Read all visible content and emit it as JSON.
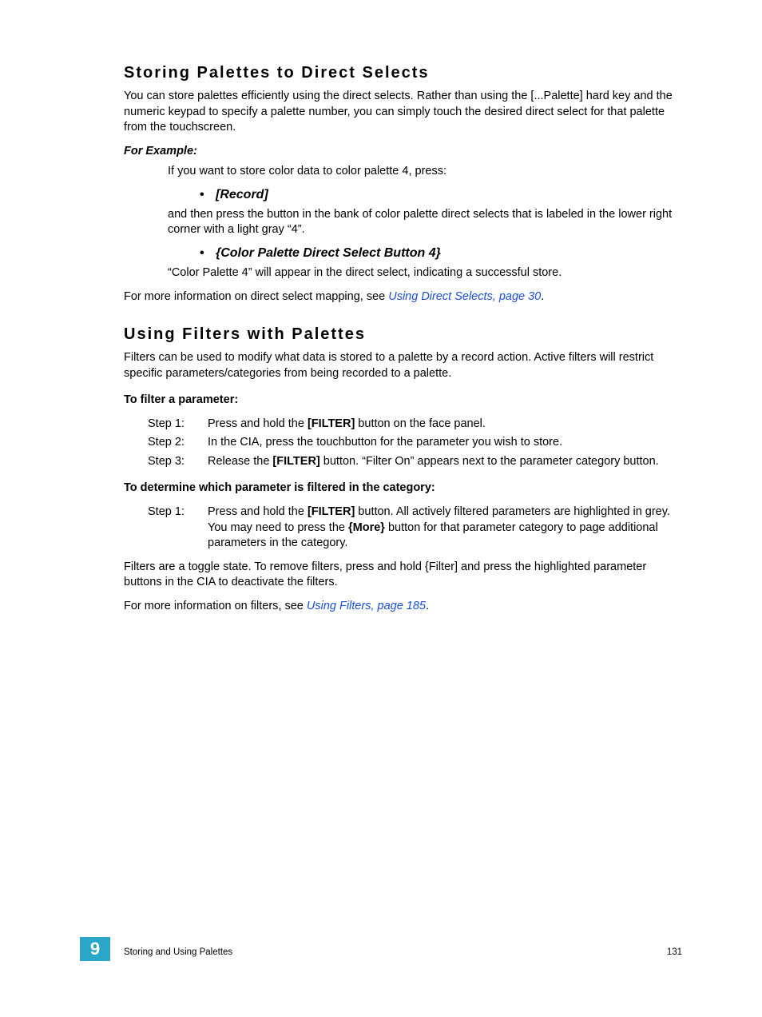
{
  "section1": {
    "heading": "Storing Palettes to Direct Selects",
    "intro": "You can store palettes efficiently using the direct selects. Rather than using the [...Palette] hard key and the numeric keypad to specify a palette number, you can simply touch the desired direct select for that palette from the touchscreen.",
    "example_label": "For Example:",
    "example_intro": "If you want to store color data to color palette 4, press:",
    "bullet1": "[Record]",
    "example_mid": "and then press the button in the bank of color palette direct selects that is labeled in the lower right corner with a light gray “4”.",
    "bullet2": "{Color Palette Direct Select Button 4}",
    "example_result": "“Color Palette 4” will appear in the direct select, indicating a successful store.",
    "more_info_pre": "For more information on direct select mapping, see ",
    "more_info_link": "Using Direct Selects, page 30",
    "more_info_post": "."
  },
  "section2": {
    "heading": "Using Filters with Palettes",
    "intro": "Filters can be used to modify what data is stored to a palette by a record action. Active filters will restrict specific parameters/categories from being recorded to a palette.",
    "filter_param_label": "To filter a parameter:",
    "steps_a": [
      {
        "label": "Step 1:",
        "pre": "Press and hold the ",
        "bold": "[FILTER]",
        "post": " button on the face panel."
      },
      {
        "label": "Step 2:",
        "text": "In the CIA, press the touchbutton for the parameter you wish to store."
      },
      {
        "label": "Step 3:",
        "pre": "Release the ",
        "bold": "[FILTER]",
        "post": " button. “Filter On” appears next to the parameter category button."
      }
    ],
    "determine_label": "To determine which parameter is filtered in the category:",
    "steps_b": [
      {
        "label": "Step 1:",
        "pre": "Press and hold the ",
        "bold1": "[FILTER]",
        "mid": " button. All actively filtered parameters are highlighted in grey. You may need to press the ",
        "bold2": "{More}",
        "post": " button for that parameter category to page additional parameters in the category."
      }
    ],
    "toggle": "Filters are a toggle state. To remove filters, press and hold {Filter] and press the highlighted parameter buttons in the CIA to deactivate the filters.",
    "more_info_pre": "For more information on filters, see ",
    "more_info_link": "Using Filters, page 185",
    "more_info_post": "."
  },
  "footer": {
    "chapter": "9",
    "title": "Storing and Using Palettes",
    "page": "131"
  }
}
